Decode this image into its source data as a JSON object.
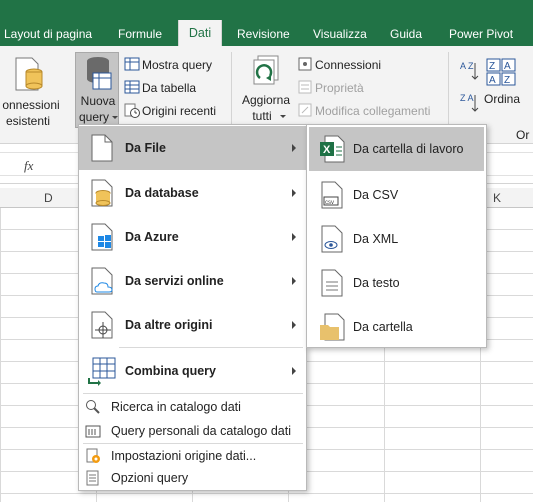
{
  "ribbon_tabs": [
    {
      "label": "Layout di pagina",
      "active": false
    },
    {
      "label": "Formule",
      "active": false
    },
    {
      "label": "Dati",
      "active": true
    },
    {
      "label": "Revisione",
      "active": false
    },
    {
      "label": "Visualizza",
      "active": false
    },
    {
      "label": "Guida",
      "active": false
    },
    {
      "label": "Power Pivot",
      "active": false
    }
  ],
  "ribbon": {
    "connessioni_esistenti": [
      "onnessioni",
      "esistenti"
    ],
    "nuova_query": [
      "Nuova",
      "query"
    ],
    "mostra_query": "Mostra query",
    "da_tabella": "Da tabella",
    "origini_recenti": "Origini recenti",
    "aggiorna_tutti": [
      "Aggiorna",
      "tutti"
    ],
    "connessioni": "Connessioni",
    "proprieta": "Proprietà",
    "modifica_collegamenti": "Modifica collegamenti",
    "ordina": "Ordina",
    "ordina_partial": "Or",
    "az": "A Z",
    "za": "Z A"
  },
  "formula_bar": {
    "fx": "fx"
  },
  "columns": {
    "d": "D",
    "k": "K"
  },
  "menu": {
    "items": [
      {
        "label": "Da File",
        "icon": "file-icon",
        "submenu": true
      },
      {
        "label": "Da database",
        "icon": "database-icon",
        "submenu": true
      },
      {
        "label": "Da Azure",
        "icon": "azure-windows-icon",
        "submenu": true
      },
      {
        "label": "Da servizi online",
        "icon": "online-services-icon",
        "submenu": true
      },
      {
        "label": "Da altre origini",
        "icon": "other-sources-icon",
        "submenu": true
      },
      {
        "label": "Combina query",
        "icon": "combine-query-icon",
        "submenu": true
      }
    ],
    "small_items": [
      {
        "label": "Ricerca in catalogo dati",
        "icon": "catalog-search-icon"
      },
      {
        "label": "Query personali da catalogo dati",
        "icon": "catalog-query-icon"
      },
      {
        "label": "Impostazioni origine dati...",
        "icon": "source-settings-icon"
      },
      {
        "label": "Opzioni query",
        "icon": "query-options-icon"
      }
    ]
  },
  "submenu": {
    "items": [
      {
        "label": "Da cartella di lavoro",
        "icon": "excel-workbook-icon",
        "highlighted": true
      },
      {
        "label": "Da CSV",
        "icon": "csv-file-icon"
      },
      {
        "label": "Da XML",
        "icon": "xml-file-icon"
      },
      {
        "label": "Da testo",
        "icon": "text-file-icon"
      },
      {
        "label": "Da cartella",
        "icon": "folder-icon"
      }
    ]
  },
  "colors": {
    "ribbon_tab_bar": "#217346",
    "menu_highlight": "#c5c5c5",
    "excel_green": "#1e7145",
    "folder": "#e8c16c"
  }
}
